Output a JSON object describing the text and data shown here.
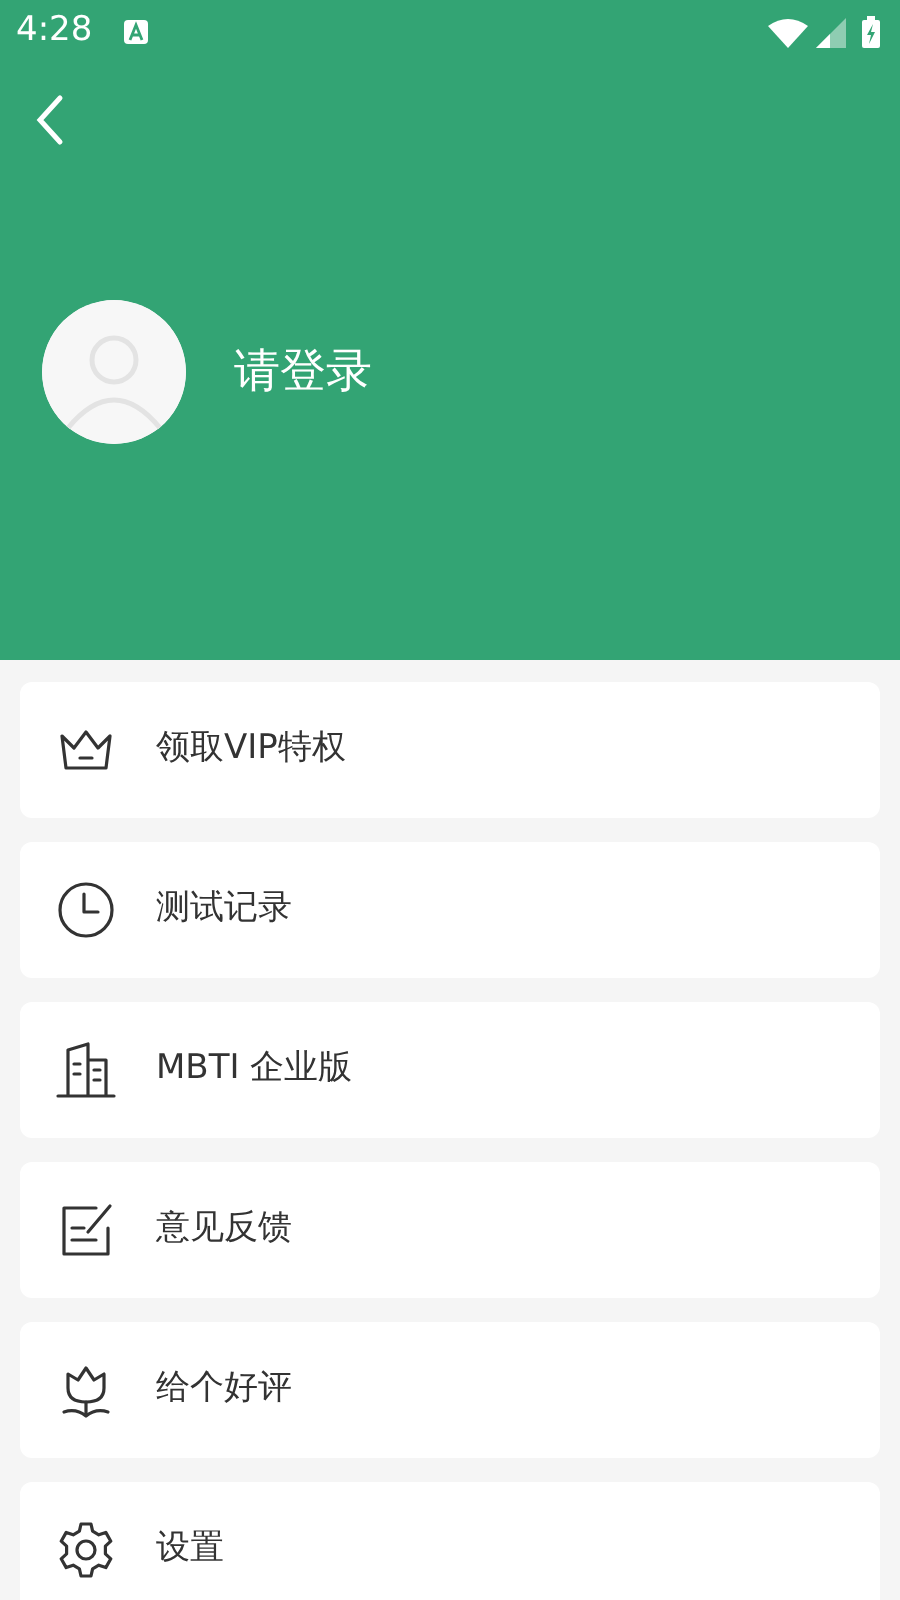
{
  "status_bar": {
    "time": "4:28"
  },
  "profile": {
    "name": "请登录"
  },
  "menu": [
    {
      "label": "领取VIP特权"
    },
    {
      "label": "测试记录"
    },
    {
      "label": "MBTI 企业版"
    },
    {
      "label": "意见反馈"
    },
    {
      "label": "给个好评"
    },
    {
      "label": "设置"
    }
  ]
}
